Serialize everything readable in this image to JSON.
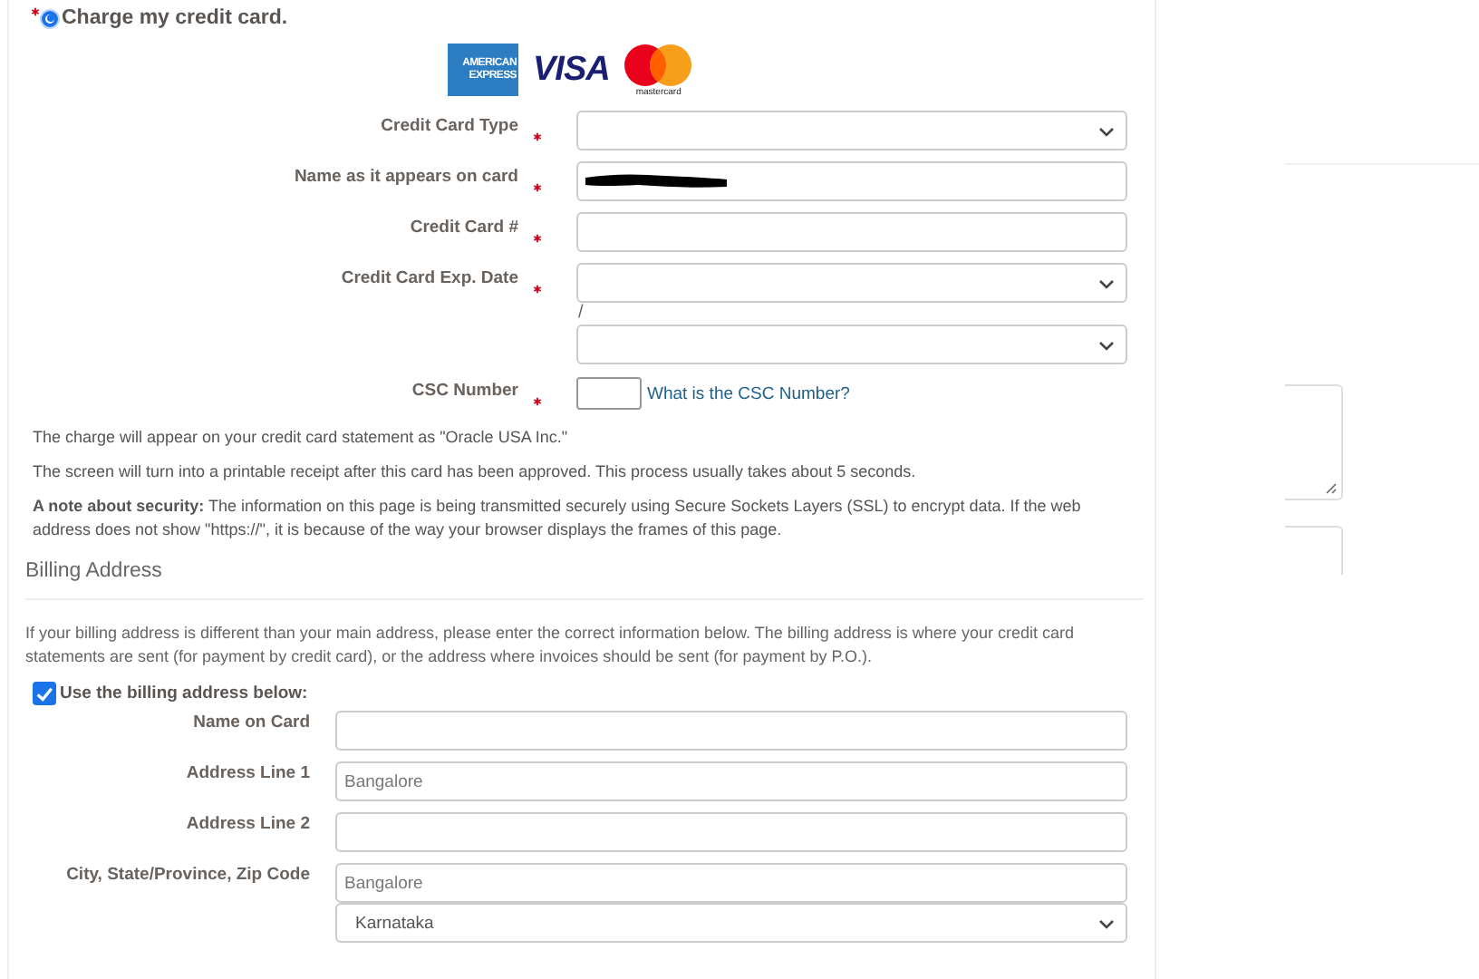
{
  "payment_option": {
    "label": "Charge my credit card.",
    "required": true,
    "selected": true
  },
  "card_logos": [
    {
      "kind": "amex",
      "lines": [
        "AMERICAN",
        "EXPRESS"
      ]
    },
    {
      "kind": "visa",
      "lines": [
        "VISA"
      ]
    },
    {
      "kind": "mastercard",
      "lines": [
        "mastercard"
      ]
    }
  ],
  "card_fields": [
    {
      "kind": "select",
      "label": "Credit Card Type",
      "required": true
    },
    {
      "kind": "text",
      "label": "Name as it appears on card",
      "required": true,
      "redacted": true
    },
    {
      "kind": "text",
      "label": "Credit Card #",
      "required": true,
      "redacted": false
    },
    {
      "kind": "date",
      "label": "Credit Card Exp. Date",
      "required": true,
      "separator": "/"
    },
    {
      "kind": "csc",
      "label": "CSC Number",
      "required": true,
      "link": "What is the CSC Number?"
    }
  ],
  "notes": [
    "The charge will appear on your credit card statement as \"Oracle USA Inc.\"",
    "The screen will turn into a printable receipt after this card has been approved. This process usually takes about 5 seconds.",
    "**A note about security:** The information on this page is being transmitted securely using Secure Sockets Layers (SSL) to encrypt data. If the web address does not show \"https://\", it is because of the way your browser displays the frames of this page."
  ],
  "billing": {
    "title": "Billing Address",
    "intro": "If your billing address is different than your main address, please enter the correct information below.  The billing address is where your credit card statements are sent (for payment by credit card), or the address where invoices should be sent (for payment by P.O.).",
    "use_billing": {
      "label": "Use the billing address below:",
      "checked": true
    },
    "fields": [
      {
        "kind": "text",
        "label": "Name on Card"
      },
      {
        "kind": "text",
        "label": "Address Line 1",
        "value": "Bangalore"
      },
      {
        "kind": "text",
        "label": "Address Line 2"
      },
      {
        "kind": "text",
        "label": "City, State/Province, Zip Code",
        "value": "Bangalore"
      },
      {
        "kind": "select",
        "value": "Karnataka"
      }
    ]
  }
}
